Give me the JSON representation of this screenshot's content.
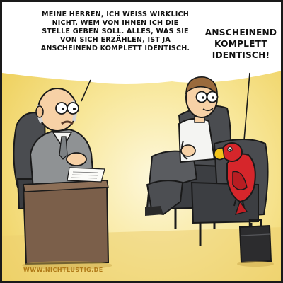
{
  "speech": {
    "interviewer": "MEINE HERREN, ICH WEISS WIRKLICH NICHT, WEM VON IHNEN ICH DIE STELLE GEBEN SOLL. ALLES, WAS SIE VON SICH ERZÄHLEN, IST JA ANSCHEINEND KOMPLETT IDENTISCH.",
    "parrot": "ANSCHEINEND KOMPLETT IDENTISCH!"
  },
  "credit": "WWW.NICHTLUSTIG.DE",
  "colors": {
    "background_wall": "#f1d668",
    "background_glow": "#fbf3c7",
    "desk": "#7b5f4a",
    "chair": "#4a4c50",
    "suit_grey": "#8f9294",
    "shirt_white": "#f4f4f2",
    "parrot_red": "#d6262b",
    "parrot_yellow": "#f2c41c",
    "outline": "#1a1a1a"
  }
}
